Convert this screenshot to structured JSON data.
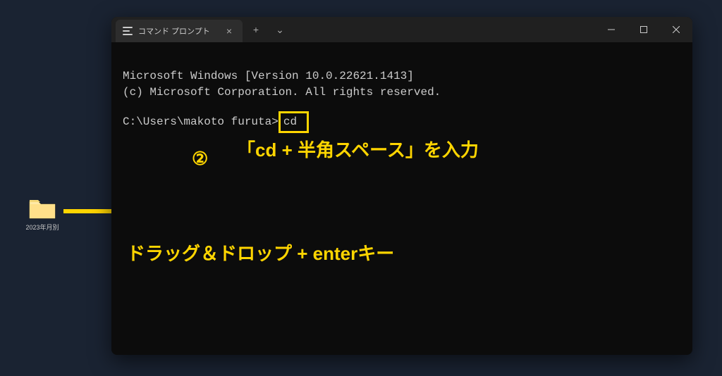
{
  "desktop": {
    "folder_label": "2023年月別"
  },
  "terminal": {
    "tab_title": "コマンド プロンプト",
    "banner_line1": "Microsoft Windows [Version 10.0.22621.1413]",
    "banner_line2": "(c) Microsoft Corporation. All rights reserved.",
    "prompt": "C:\\Users\\makoto furuta>",
    "command": "cd "
  },
  "annotations": {
    "step_number": "②",
    "instruction1": "「cd + 半角スペース」を入力",
    "instruction2": "ドラッグ＆ドロップ + enterキー"
  },
  "colors": {
    "highlight": "#ffd500",
    "desktop_bg": "#1a2332",
    "terminal_bg": "#0c0c0c"
  }
}
